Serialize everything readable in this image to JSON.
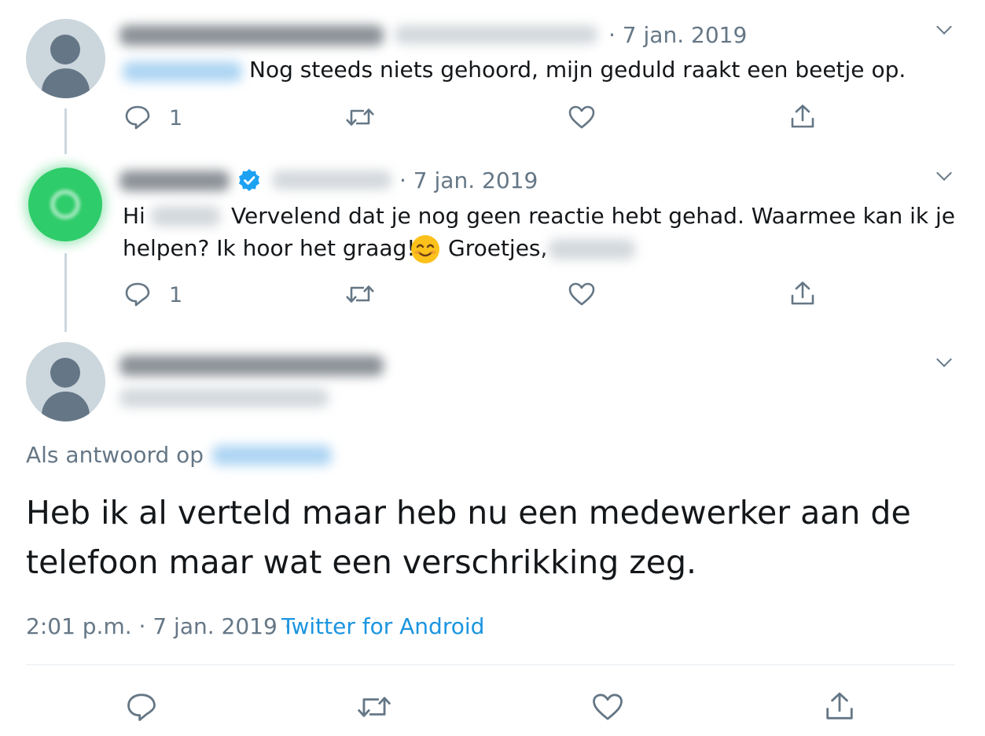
{
  "tweets": [
    {
      "date": "· 7 jan. 2019",
      "text": "Nog steeds niets gehoord, mijn geduld raakt een beetje op.",
      "reply_count": "1"
    },
    {
      "date": "· 7 jan. 2019",
      "text_hi": "Hi",
      "text_line1": "Vervelend dat je nog geen reactie hebt gehad. Waarmee kan ik je",
      "text_line2": "helpen? Ik hoor het graag!",
      "text_sign": "Groetjes,",
      "reply_count": "1"
    }
  ],
  "main_tweet": {
    "reply_prefix": "Als antwoord op",
    "text_line1": "Heb ik al verteld maar heb nu een medewerker aan de",
    "text_line2": "telefoon maar wat een verschrikking zeg.",
    "timestamp": "2:01 p.m. · 7 jan. 2019 ·",
    "source": "Twitter for Android"
  },
  "icons": [
    "chevron-down-icon",
    "reply-icon",
    "retweet-icon",
    "like-icon",
    "share-icon",
    "verified-icon",
    "smiling-face-emoji",
    "default-avatar-icon"
  ],
  "colors": {
    "text": "#14171a",
    "meta": "#657786",
    "link": "#1b95e0",
    "verified": "#1da1f2",
    "thread_line": "#ccd6dd",
    "brand_avatar": "#2ecc6a"
  }
}
